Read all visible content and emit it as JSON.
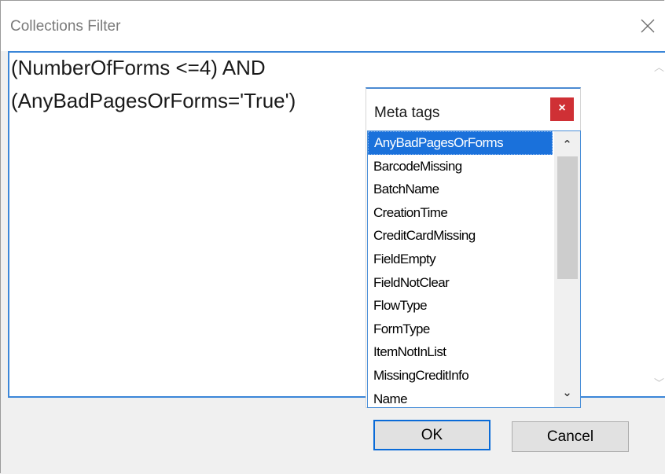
{
  "window": {
    "title": "Collections Filter"
  },
  "editor": {
    "lines": [
      "(NumberOfForms <=4) AND",
      "(AnyBadPagesOrForms='True')"
    ]
  },
  "popup": {
    "title": "Meta tags",
    "close_label": "×",
    "items": [
      "AnyBadPagesOrForms",
      "BarcodeMissing",
      "BatchName",
      "CreationTime",
      "CreditCardMissing",
      "FieldEmpty",
      "FieldNotClear",
      "FlowType",
      "FormType",
      "ItemNotInList",
      "MissingCreditInfo",
      "Name"
    ],
    "selected_item": "AnyBadPagesOrForms"
  },
  "buttons": {
    "ok": "OK",
    "cancel": "Cancel"
  },
  "icons": {
    "window_close": "close-icon",
    "scroll_up": "chevron-up-icon",
    "scroll_down": "chevron-down-icon"
  },
  "colors": {
    "accent": "#1a71db",
    "focus_border": "#3b86d8",
    "popup_close": "#cf3035"
  }
}
